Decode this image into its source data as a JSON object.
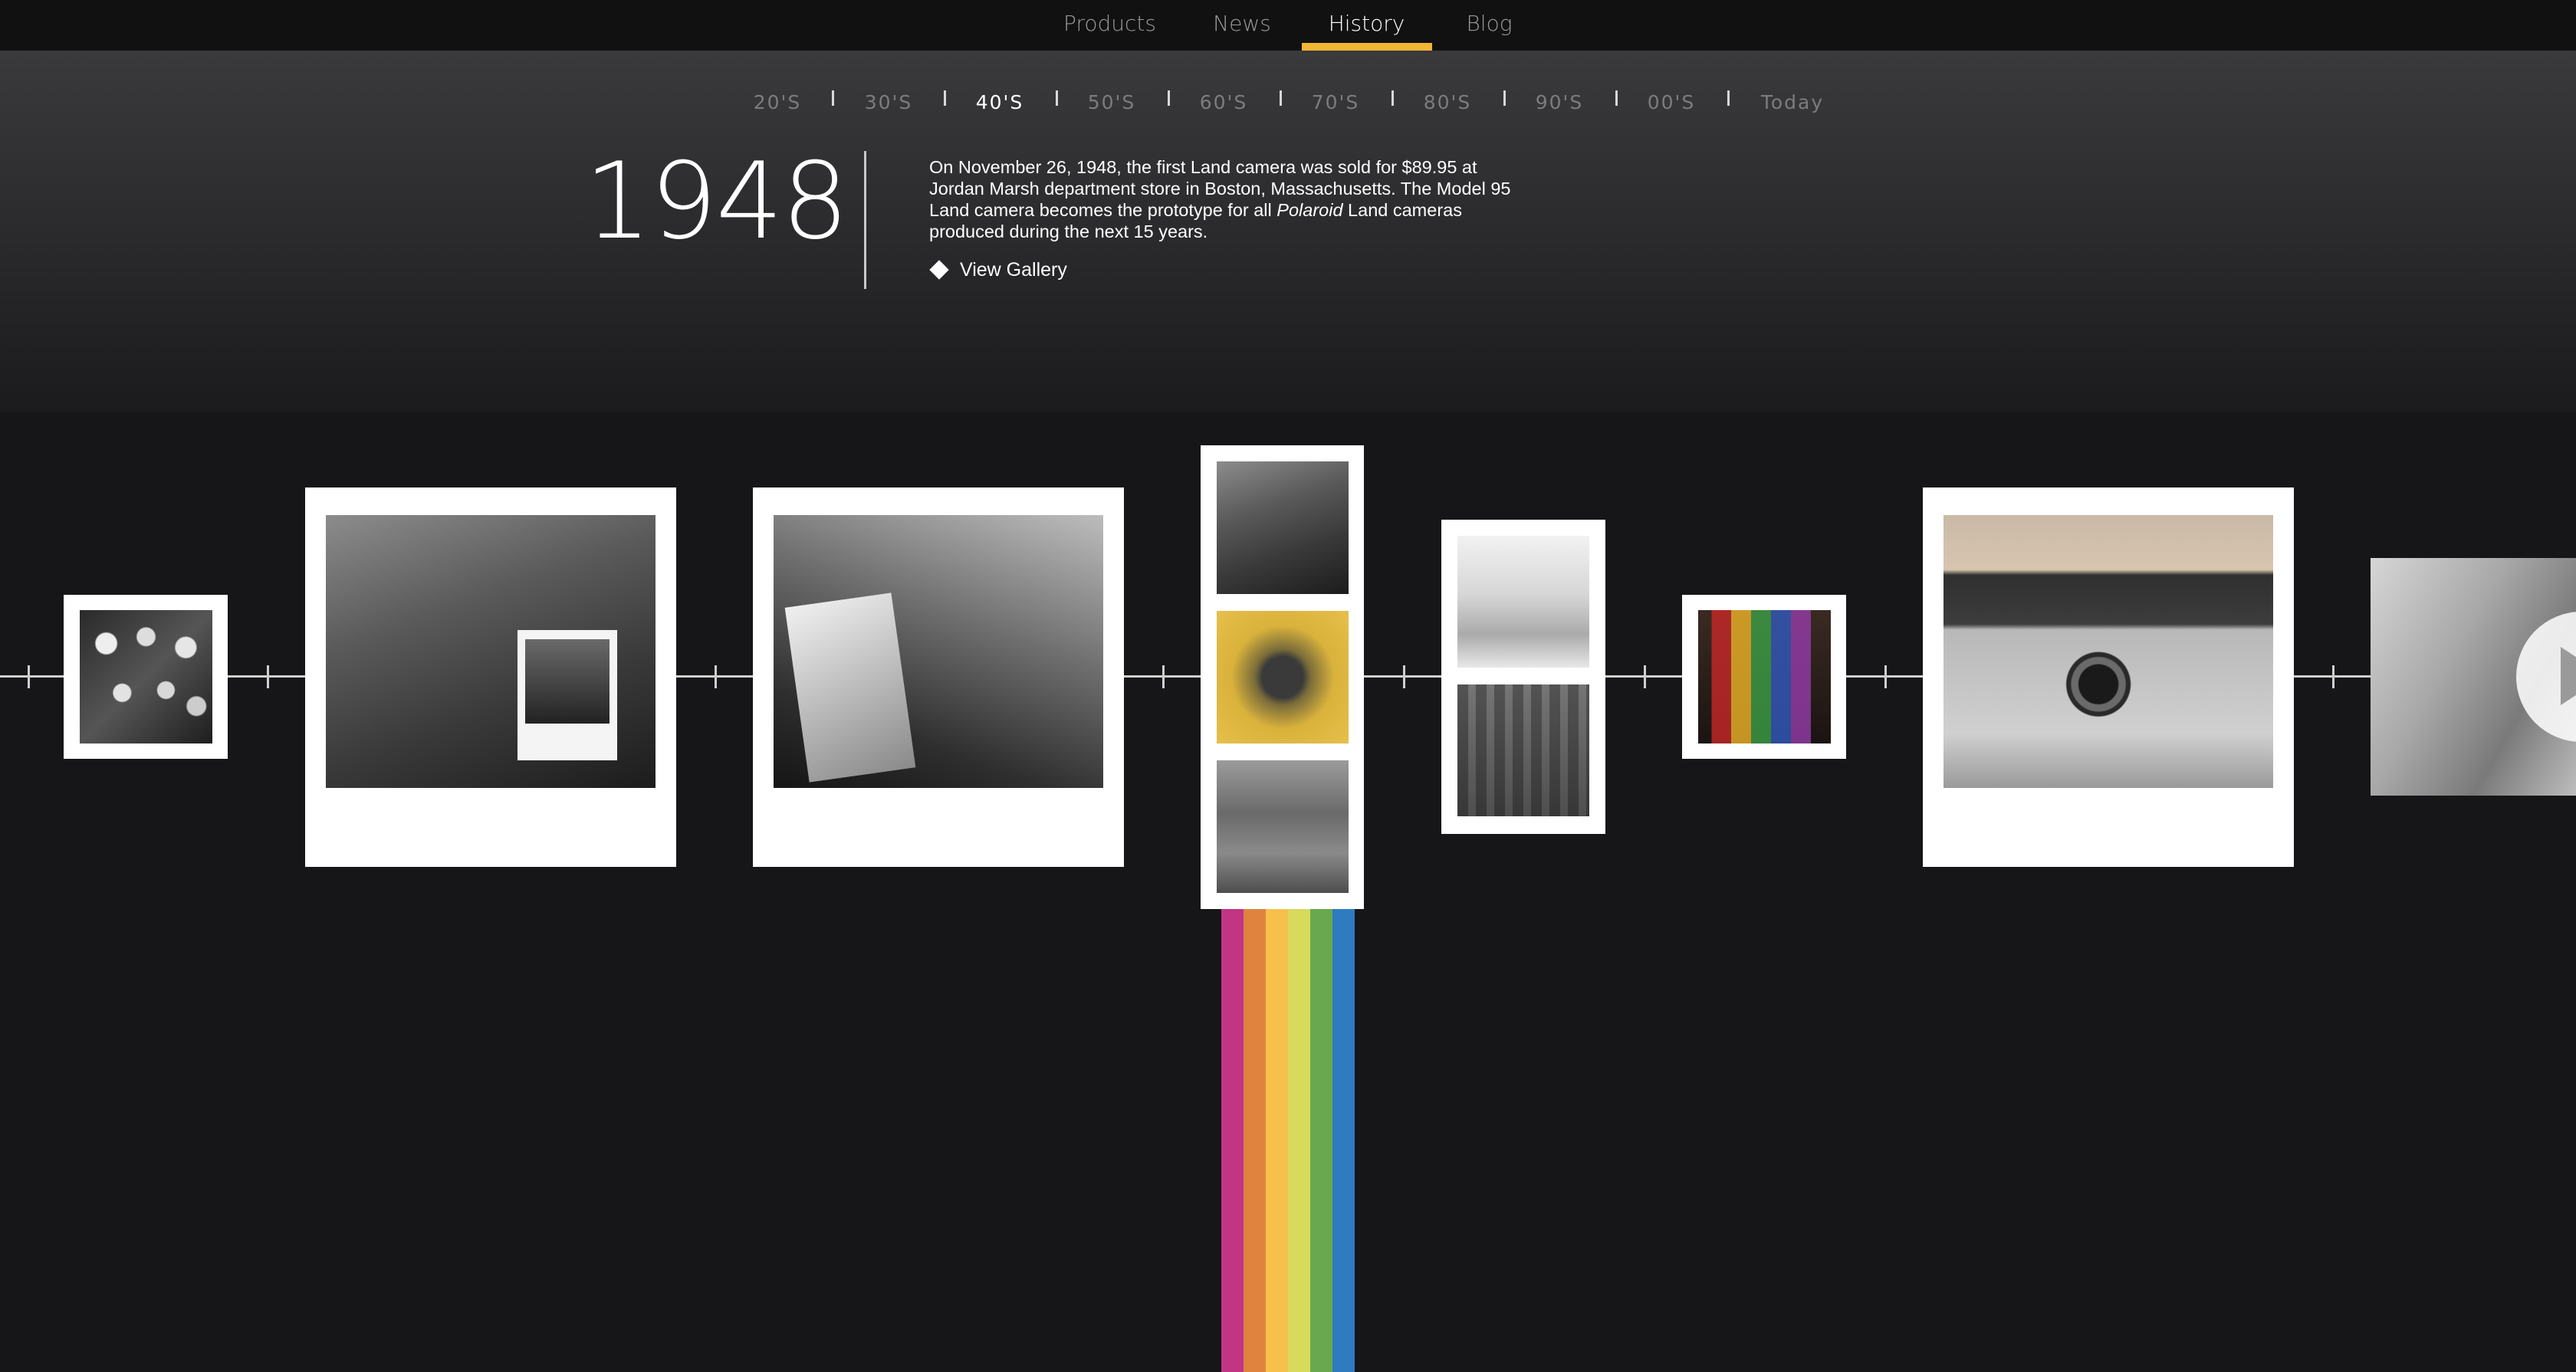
{
  "nav": {
    "items": [
      {
        "label": "Products"
      },
      {
        "label": "News"
      },
      {
        "label": "History"
      },
      {
        "label": "Blog"
      }
    ],
    "active_index": 2,
    "accent_color": "#f2b534"
  },
  "decades": {
    "items": [
      "20'S",
      "30'S",
      "40'S",
      "50'S",
      "60'S",
      "70'S",
      "80'S",
      "90'S",
      "00'S",
      "Today"
    ],
    "active_index": 2
  },
  "entry": {
    "year": "1948",
    "desc_part1": "On November 26, 1948, the first Land camera was sold for $89.95 at Jordan Marsh department store in Boston, Massachusetts. The Model 95 Land camera becomes the prototype for all ",
    "desc_italic": "Polaroid",
    "desc_part2": " Land cameras produced during the next 15 years.",
    "gallery_label": "View Gallery",
    "gallery_icon": "diamond-icon"
  },
  "timeline": {
    "photos": [
      {
        "name": "photo-audience-3d-glasses",
        "subject": "audience wearing 3D glasses"
      },
      {
        "name": "photo-land-holding-print",
        "subject": "Edwin Land holding instant print"
      },
      {
        "name": "photo-land-with-negative",
        "subject": "Edwin Land with photo negative"
      },
      {
        "name": "photo-land-camera-model-95",
        "subject": "Model 95 Land camera"
      },
      {
        "name": "photo-camera-factory",
        "subject": "camera and factory floor"
      },
      {
        "name": "photo-color-demo",
        "subject": "man with color chart"
      },
      {
        "name": "photo-automatic-camera",
        "subject": "Polaroid automatic camera"
      },
      {
        "name": "photo-video-thumbnail",
        "subject": "video with play button"
      }
    ],
    "video_icon": "play-icon"
  },
  "rainbow_colors": [
    "#c13584",
    "#e0833f",
    "#f5c14b",
    "#d8da5c",
    "#6aa84f",
    "#2f7bbf"
  ]
}
